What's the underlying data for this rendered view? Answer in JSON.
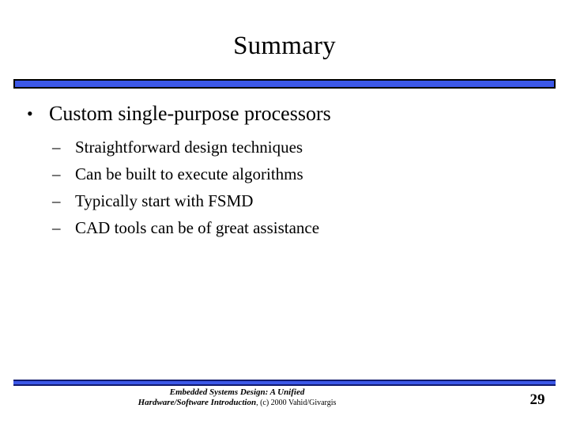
{
  "slide": {
    "title": "Summary",
    "page_number": "29",
    "accent_color": "#3c58e8",
    "accent_border_color": "#000000",
    "footer_rule_color": "#111a6e",
    "background_color": "#ffffff",
    "text_color": "#000000"
  },
  "content": {
    "bullets": [
      {
        "marker": "•",
        "text": "Custom single-purpose processors",
        "children": [
          {
            "marker": "–",
            "text": "Straightforward design techniques"
          },
          {
            "marker": "–",
            "text": "Can be built to execute algorithms"
          },
          {
            "marker": "–",
            "text": "Typically start with FSMD"
          },
          {
            "marker": "–",
            "text": "CAD tools can be of great assistance"
          }
        ]
      }
    ]
  },
  "footer": {
    "book_line1": "Embedded Systems Design: A Unified",
    "book_line2": "Hardware/Software Introduction",
    "copyright": ", (c) 2000 Vahid/Givargis"
  }
}
